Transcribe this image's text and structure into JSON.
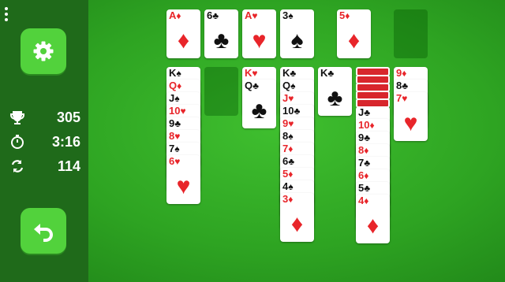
{
  "sidebar": {
    "settings_icon": "gear-icon",
    "undo_icon": "undo-icon",
    "menu_icon": "more-vert-icon",
    "score_icon": "trophy-icon",
    "time_icon": "stopwatch-icon",
    "moves_icon": "cycle-icon",
    "score": "305",
    "time": "3:16",
    "moves": "114"
  },
  "colors": {
    "red": "#e8252a",
    "black": "#111111",
    "felt": "#2ea422",
    "button": "#52d23c"
  },
  "foundations": [
    {
      "rank": "A",
      "suit": "♦",
      "color": "red"
    },
    {
      "rank": "6",
      "suit": "♣",
      "color": "black"
    },
    {
      "rank": "A",
      "suit": "♥",
      "color": "red"
    },
    {
      "rank": "3",
      "suit": "♠",
      "color": "black"
    }
  ],
  "waste": {
    "rank": "5",
    "suit": "♦",
    "color": "red"
  },
  "stock": "empty",
  "tableau": [
    {
      "hidden": 0,
      "cards": [
        {
          "rank": "K",
          "suit": "♠",
          "color": "black"
        },
        {
          "rank": "Q",
          "suit": "♦",
          "color": "red"
        },
        {
          "rank": "J",
          "suit": "♠",
          "color": "black"
        },
        {
          "rank": "10",
          "suit": "♥",
          "color": "red"
        },
        {
          "rank": "9",
          "suit": "♣",
          "color": "black"
        },
        {
          "rank": "8",
          "suit": "♥",
          "color": "red"
        },
        {
          "rank": "7",
          "suit": "♠",
          "color": "black"
        },
        {
          "rank": "6",
          "suit": "♥",
          "color": "red"
        }
      ]
    },
    {
      "hidden": 0,
      "cards": []
    },
    {
      "hidden": 0,
      "cards": [
        {
          "rank": "K",
          "suit": "♥",
          "color": "red"
        },
        {
          "rank": "Q",
          "suit": "♣",
          "color": "black"
        }
      ]
    },
    {
      "hidden": 0,
      "cards": [
        {
          "rank": "K",
          "suit": "♣",
          "color": "black"
        },
        {
          "rank": "Q",
          "suit": "♠",
          "color": "black"
        },
        {
          "rank": "J",
          "suit": "♥",
          "color": "red"
        },
        {
          "rank": "10",
          "suit": "♣",
          "color": "black"
        },
        {
          "rank": "9",
          "suit": "♥",
          "color": "red"
        },
        {
          "rank": "8",
          "suit": "♠",
          "color": "black"
        },
        {
          "rank": "7",
          "suit": "♦",
          "color": "red"
        },
        {
          "rank": "6",
          "suit": "♣",
          "color": "black"
        },
        {
          "rank": "5",
          "suit": "♦",
          "color": "red"
        },
        {
          "rank": "4",
          "suit": "♠",
          "color": "black"
        },
        {
          "rank": "3",
          "suit": "♦",
          "color": "red"
        }
      ]
    },
    {
      "hidden": 0,
      "cards": [
        {
          "rank": "K",
          "suit": "♣",
          "color": "black"
        }
      ]
    },
    {
      "hidden": 5,
      "cards": [
        {
          "rank": "J",
          "suit": "♣",
          "color": "black"
        },
        {
          "rank": "10",
          "suit": "♦",
          "color": "red"
        },
        {
          "rank": "9",
          "suit": "♣",
          "color": "black"
        },
        {
          "rank": "8",
          "suit": "♦",
          "color": "red"
        },
        {
          "rank": "7",
          "suit": "♣",
          "color": "black"
        },
        {
          "rank": "6",
          "suit": "♦",
          "color": "red"
        },
        {
          "rank": "5",
          "suit": "♣",
          "color": "black"
        },
        {
          "rank": "4",
          "suit": "♦",
          "color": "red"
        }
      ]
    },
    {
      "hidden": 0,
      "cards": [
        {
          "rank": "9",
          "suit": "♦",
          "color": "red"
        },
        {
          "rank": "8",
          "suit": "♣",
          "color": "black"
        },
        {
          "rank": "7",
          "suit": "♥",
          "color": "red"
        }
      ]
    }
  ]
}
